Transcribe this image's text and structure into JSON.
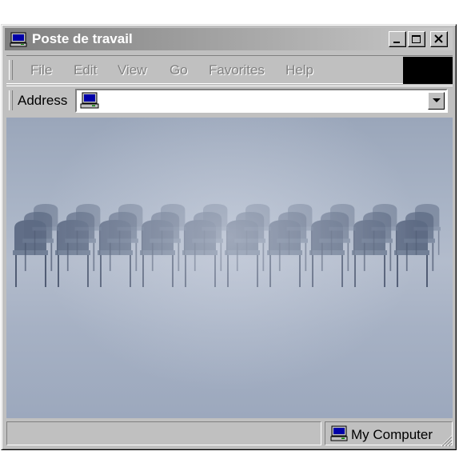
{
  "window": {
    "title": "Poste de travail",
    "buttons": {
      "minimize": "minimize",
      "maximize": "maximize",
      "close": "close"
    }
  },
  "menu": {
    "items": [
      {
        "label": "File"
      },
      {
        "label": "Edit"
      },
      {
        "label": "View"
      },
      {
        "label": "Go"
      },
      {
        "label": "Favorites"
      },
      {
        "label": "Help"
      }
    ]
  },
  "address": {
    "label": "Address",
    "value": "",
    "icon": "computer-icon"
  },
  "content": {
    "image": "rows-of-chairs-in-fog"
  },
  "status": {
    "left": "",
    "zone": "My Computer",
    "icon": "computer-icon"
  },
  "colors": {
    "face": "#c0c0c0",
    "titlebar_inactive_start": "#808080",
    "titlebar_inactive_end": "#c8c8c8",
    "content_tint": "#a9b4c6"
  }
}
